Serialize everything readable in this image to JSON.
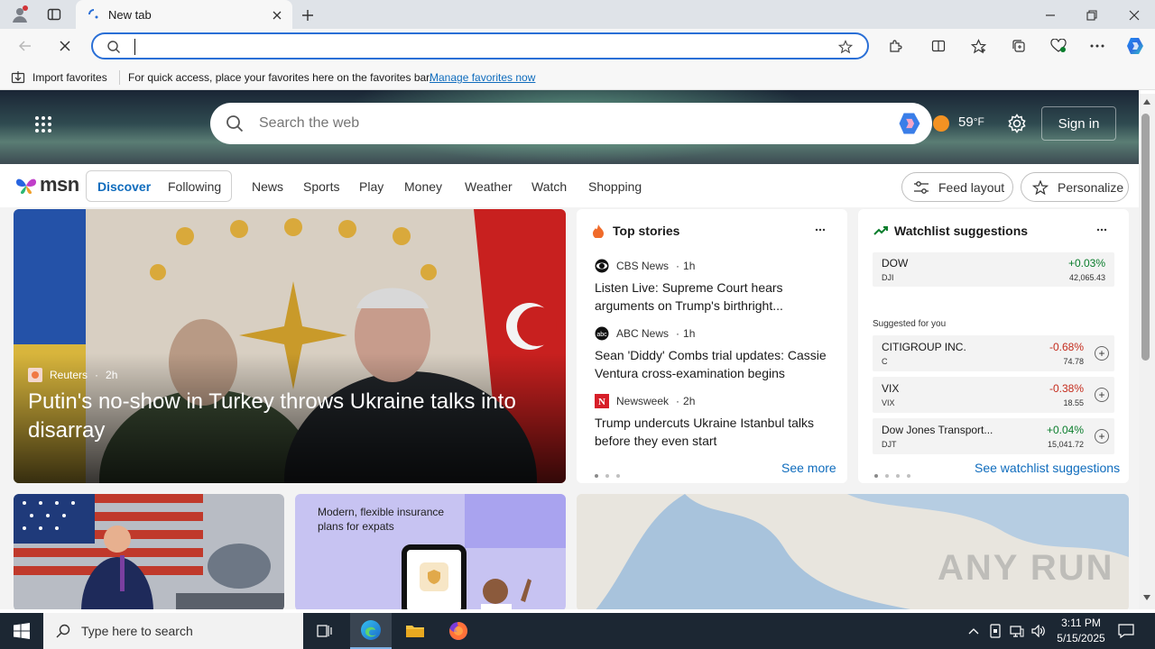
{
  "browser": {
    "tab_title": "New tab",
    "address_value": "",
    "fav_bar": {
      "import_label": "Import favorites",
      "message": "For quick access, place your favorites here on the favorites bar.",
      "manage_link": "Manage favorites now"
    }
  },
  "msn": {
    "search_placeholder": "Search the web",
    "weather_temp": "59",
    "weather_unit": "°F",
    "sign_in": "Sign in",
    "logo_text": "msn",
    "tabs": [
      "Discover",
      "Following"
    ],
    "nav": [
      "News",
      "Sports",
      "Play",
      "Money",
      "Weather",
      "Watch",
      "Shopping"
    ],
    "feed_layout": "Feed layout",
    "personalize": "Personalize"
  },
  "hero": {
    "source": "Reuters",
    "age": "2h",
    "headline": "Putin's no-show in Turkey throws Ukraine talks into disarray"
  },
  "top_stories": {
    "title": "Top stories",
    "items": [
      {
        "source": "CBS News",
        "age": "1h",
        "headline": "Listen Live: Supreme Court hears arguments on Trump's birthright..."
      },
      {
        "source": "ABC News",
        "age": "1h",
        "headline": "Sean 'Diddy' Combs trial updates: Cassie Ventura cross-examination begins"
      },
      {
        "source": "Newsweek",
        "age": "2h",
        "headline": "Trump undercuts Ukraine Istanbul talks before they even start"
      }
    ],
    "see_more": "See more"
  },
  "watchlist": {
    "title": "Watchlist suggestions",
    "dow": {
      "name": "DOW",
      "symbol": "DJI",
      "change": "+0.03%",
      "price": "42,065.43"
    },
    "suggested_label": "Suggested for you",
    "items": [
      {
        "name": "CITIGROUP INC.",
        "symbol": "C",
        "change": "-0.68%",
        "price": "74.78"
      },
      {
        "name": "VIX",
        "symbol": "VIX",
        "change": "-0.38%",
        "price": "18.55"
      },
      {
        "name": "Dow Jones Transport...",
        "symbol": "DJT",
        "change": "+0.04%",
        "price": "15,041.72"
      }
    ],
    "see_all": "See watchlist suggestions"
  },
  "ad": {
    "text": "Modern, flexible insurance plans for expats"
  },
  "watermark": "ANY RUN",
  "taskbar": {
    "search_placeholder": "Type here to search",
    "time": "3:11 PM",
    "date": "5/15/2025"
  },
  "colors": {
    "accent": "#0f6cbd",
    "positive": "#0a7d2c",
    "negative": "#c42b1c"
  }
}
